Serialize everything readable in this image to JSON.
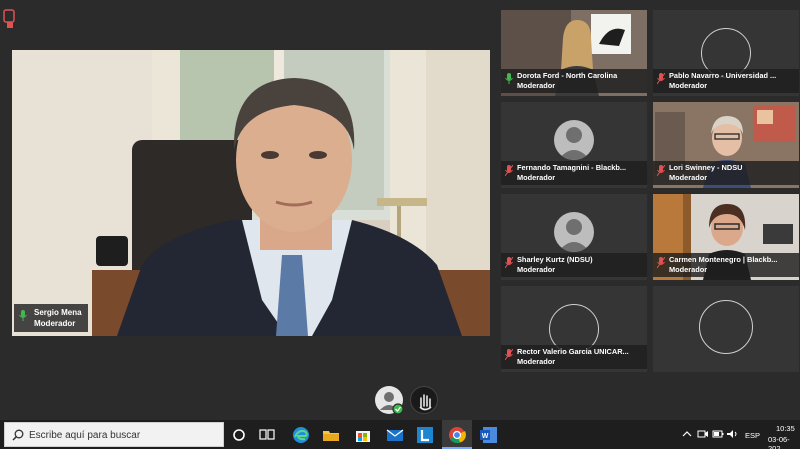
{
  "main_speaker": {
    "name": "Sergio Mena",
    "role": "Moderador"
  },
  "participants": [
    {
      "name": "Dorota Ford - North Carolina",
      "role": "Moderador"
    },
    {
      "name": "Pablo Navarro - Universidad ...",
      "role": "Moderador"
    },
    {
      "name": "Fernando Tamagnini - Blackb...",
      "role": "Moderador"
    },
    {
      "name": "Lori Swinney - NDSU",
      "role": "Moderador"
    },
    {
      "name": "Sharley Kurtz (NDSU)",
      "role": "Moderador"
    },
    {
      "name": "Carmen Montenegro | Blackb...",
      "role": "Moderador"
    },
    {
      "name": "Rector Valerio Garcia UNICAR...",
      "role": "Moderador"
    }
  ],
  "taskbar": {
    "search_placeholder": "Escribe aquí para buscar",
    "language": "ESP",
    "time": "10:35",
    "date": "03-06-202"
  },
  "colors": {
    "background": "#2b2b2b",
    "tile": "#353535",
    "mic_green": "#3fb950",
    "muted_red": "#e05252",
    "taskbar": "#1e1e1e"
  }
}
